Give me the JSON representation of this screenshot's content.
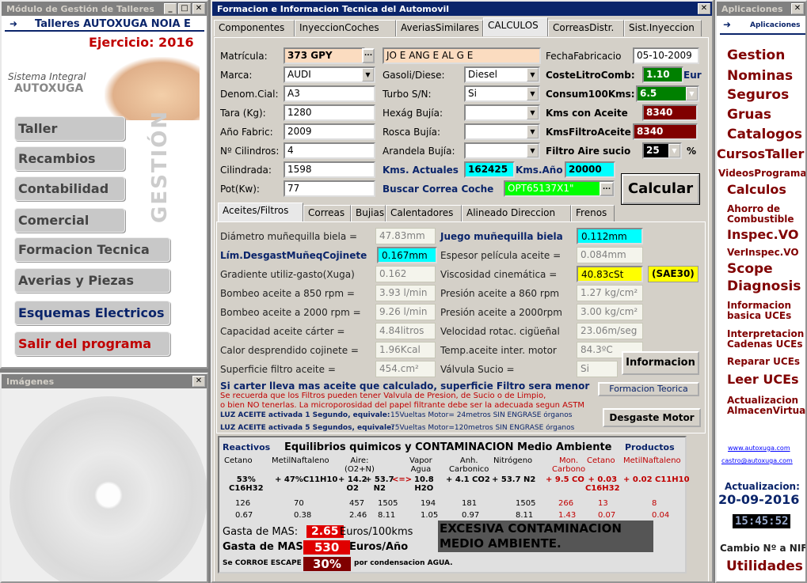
{
  "left": {
    "title": "Módulo de Gestión de Talleres",
    "shop": "Talleres AUTOXUGA NOIA E",
    "year": "Ejercicio: 2016",
    "sistema": "Sistema Integral",
    "autoxuga": "AUTOXUGA",
    "gestion": "GESTIÓN",
    "menu": [
      "Taller",
      "Recambios",
      "Contabilidad",
      "Comercial",
      "Formacion Tecnica",
      "Averias y Piezas",
      "Esquemas Electricos",
      "Salir del programa"
    ]
  },
  "images": {
    "title": "Imágenes"
  },
  "main": {
    "title": "Formacion e Informacion Tecnica del Automovil",
    "tabs": [
      "Componentes",
      "InyeccionCoches",
      "AveriasSimilares",
      "CALCULOS",
      "CorreasDistr.",
      "Sist.Inyeccion"
    ],
    "fields": {
      "matricula_l": "Matrícula:",
      "matricula": "373 GPY",
      "owner": "JO E ANG E AL G E",
      "fecha_l": "FechaFabricacio",
      "fecha": "05-10-2009",
      "marca_l": "Marca:",
      "marca": "AUDI",
      "gasoli_l": "Gasoli/Diese:",
      "gasoli": "Diesel",
      "coste_l": "CosteLitroComb:",
      "coste": "1.10",
      "eur": "Eur",
      "denom_l": "Denom.Cial:",
      "denom": "A3",
      "turbo_l": "Turbo S/N:",
      "turbo": "Si",
      "consum_l": "Consum100Kms:",
      "consum": "6.5",
      "tara_l": "Tara (Kg):",
      "tara": "1280",
      "hexag_l": "Hexág Bujía:",
      "kmsaceite_l": "Kms con Aceite",
      "kmsaceite": "8340",
      "anio_l": "Año Fabric:",
      "anio": "2009",
      "rosca_l": "Rosca Bujía:",
      "kmsfiltro_l": "KmsFiltroAceite",
      "kmsfiltro": "8340",
      "cil_l": "Nº Cilindros:",
      "cil": "4",
      "arandela_l": "Arandela Bujía:",
      "filtro_l": "Filtro Aire sucio",
      "filtro": "25",
      "pct": "%",
      "cilindrada_l": "Cilindrada:",
      "cilindrada": "1598",
      "kmsact_l": "Kms. Actuales",
      "kmsact": "162425",
      "kmsano_l": "Kms.Año",
      "kmsano": "20000",
      "pot_l": "Pot(Kw):",
      "pot": "77",
      "buscar_l": "Buscar Correa Coche",
      "buscar": "OPT65137X1\"",
      "calcular": "Calcular"
    },
    "subtabs": [
      "Aceites/Filtros",
      "Correas",
      "Bujias",
      "Calentadores",
      "Alineado Direccion",
      "Frenos"
    ],
    "rows": [
      {
        "l": "Diámetro muñequilla biela =",
        "v": "47.83mm",
        "r": "Juego muñequilla biela",
        "rv": "0.112mm"
      },
      {
        "l": "Lím.DesgastMuñeqCojinete",
        "v": "0.167mm",
        "r": "Espesor película aceite =",
        "rv": "0.084mm"
      },
      {
        "l": "Gradiente utiliz-gasto(Xuga)",
        "v": "0.162",
        "r": "Viscosidad cinemática =",
        "rv": "40.83cSt",
        "extra": "(SAE30)"
      },
      {
        "l": "Bombeo aceite a 850 rpm =",
        "v": "3.93 l/min",
        "r": "Presión aceite a 860 rpm",
        "rv": "1.27 kg/cm²"
      },
      {
        "l": "Bombeo aceite a 2000 rpm =",
        "v": "9.26 l/min",
        "r": "Presión aceite a 2000rpm",
        "rv": "3.00 kg/cm²"
      },
      {
        "l": "Capacidad aceite cárter =",
        "v": "4.84litros",
        "r": "Velocidad rotac. cigüeñal",
        "rv": "23.06m/seg"
      },
      {
        "l": "Calor desprendido cojinete =",
        "v": "1.96Kcal",
        "r": "Temp.aceite inter. motor",
        "rv": "84.3ºC"
      },
      {
        "l": "Superficie filtro aceite =",
        "v": "454.cm²",
        "r": "Válvula Sucio =",
        "rv": "Si"
      }
    ],
    "informacion": "Informacion",
    "warn": "Si carter lleva mas aceite que calculado, superficie Filtro sera menor",
    "red1": "Se recuerda que los Filtros pueden tener Valvula de Presion, de Sucio o de Limpio,",
    "red2": "o bien NO tenerlas. La microporosidad del papel filtrante debe ser la adecuada segun ASTM",
    "formteo": "Formacion Teorica",
    "luz1a": "LUZ ACEITE activada 1 Segundo, equivale:",
    "luz1b": "15Vueltas Motor= 24metros SIN ENGRASE órganos",
    "luz2a": "LUZ ACEITE activada 5 Segundos, equivale:",
    "luz2b": "75Vueltas Motor=120metros SIN ENGRASE órganos",
    "desgaste": "Desgaste Motor",
    "chem": {
      "react": "Reactivos",
      "title": "Equilibrios quimicos y CONTAMINACION Medio Ambiente",
      "prod": "Productos",
      "heads": [
        "Cetano",
        "MetilNaftaleno",
        "Aire:\n(O2+N)",
        "Vapor\nAgua",
        "Anh.\nCarbonico",
        "Nitrógeno",
        "Mon.\nCarbono",
        "Cetano",
        "MetilNaftaleno"
      ],
      "eq": [
        "53%\nC16H32",
        "+ 47%C11H10",
        "+ 14.2\nO2",
        "+ 53.7\nN2",
        "<=>",
        "10.8\nH2O",
        "+ 4.1 CO2",
        "+ 53.7 N2",
        "+ 9.5 CO",
        "+ 0.03\nC16H32",
        "+ 0.02 C11H10"
      ],
      "r1": [
        "126",
        "70",
        "457",
        "1505",
        "194",
        "181",
        "1505",
        "266",
        "13",
        "8"
      ],
      "r2": [
        "0.67",
        "0.38",
        "2.46",
        "8.11",
        "1.05",
        "0.97",
        "8.11",
        "1.43",
        "0.07",
        "0.04"
      ],
      "gasta1_l": "Gasta de MAS:",
      "gasta1": "2.65",
      "gasta1_u": "Euros/100kms",
      "gasta2_l": "Gasta de MAS",
      "gasta2": "530",
      "gasta2_u": "Euros/Año",
      "excesiva": "EXCESIVA CONTAMINACION MEDIO AMBIENTE.",
      "corroe_l": "Se CORROE ESCAPE",
      "corroe": "30%",
      "corroe_u": "por condensacion AGUA."
    }
  },
  "apps": {
    "title": "Aplicaciones",
    "header": "Aplicaciones",
    "items": [
      "Gestion",
      "Nominas",
      "Seguros",
      "Gruas",
      "Catalogos",
      "CursosTaller",
      "VideosProgramas",
      "Calculos",
      "Ahorro de Combustible",
      "Inspec.VO",
      "VerInspec.VO",
      "Scope",
      "Diagnosis",
      "Informacion basica UCEs",
      "Interpretacion Cadenas UCEs",
      "Reparar UCEs",
      "Leer UCEs",
      "Actualizacion AlmacenVirtual"
    ],
    "web": "www.autoxuga.com",
    "mail": "castro@autoxuga.com",
    "act_l": "Actualizacion:",
    "act": "20-09-2016",
    "clock": "15:45:52",
    "cambio": "Cambio Nº a NIF",
    "util": "Utilidades"
  }
}
